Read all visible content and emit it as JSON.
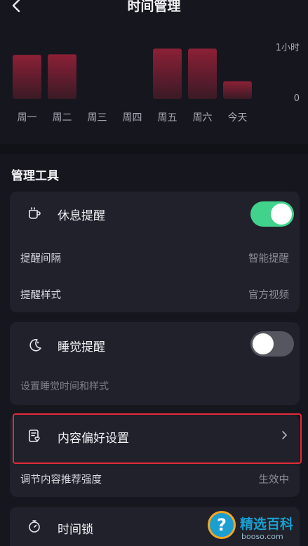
{
  "header": {
    "title": "时间管理",
    "back_icon": "chevron-left-icon"
  },
  "chart_data": {
    "type": "bar",
    "categories": [
      "周一",
      "周二",
      "周三",
      "周四",
      "周五",
      "周六",
      "今天"
    ],
    "values": [
      0.85,
      0.86,
      0,
      0,
      0.97,
      0.97,
      0.34
    ],
    "value_unit": "hours",
    "ylim": [
      0,
      1.4
    ],
    "y_tick_labels": {
      "top": "1小时",
      "bottom": "0"
    },
    "top_tick_value": 1.0,
    "grid": false,
    "bar_color_top": "#8c2036",
    "bar_color_bottom": "#3a1a26"
  },
  "section": {
    "title": "管理工具"
  },
  "rest_reminder": {
    "icon": "cup-icon",
    "label": "休息提醒",
    "toggle_on": true,
    "interval_label": "提醒间隔",
    "interval_value": "智能提醒",
    "style_label": "提醒样式",
    "style_value": "官方视频"
  },
  "sleep_reminder": {
    "icon": "moon-icon",
    "label": "睡觉提醒",
    "toggle_on": false,
    "hint": "设置睡觉时间和样式"
  },
  "content_pref": {
    "icon": "clipboard-heart-icon",
    "label": "内容偏好设置",
    "sub_label": "调节内容推荐强度",
    "sub_value": "生效中"
  },
  "time_lock": {
    "icon": "timer-icon",
    "label": "时间锁"
  },
  "watermark": {
    "name": "精选百科",
    "url": "booso.com",
    "badge": "?"
  },
  "colors": {
    "background": "#16161e",
    "card": "#20212b",
    "toggle_on": "#41d38c",
    "toggle_off": "#55565f",
    "highlight": "#e12b3a"
  }
}
